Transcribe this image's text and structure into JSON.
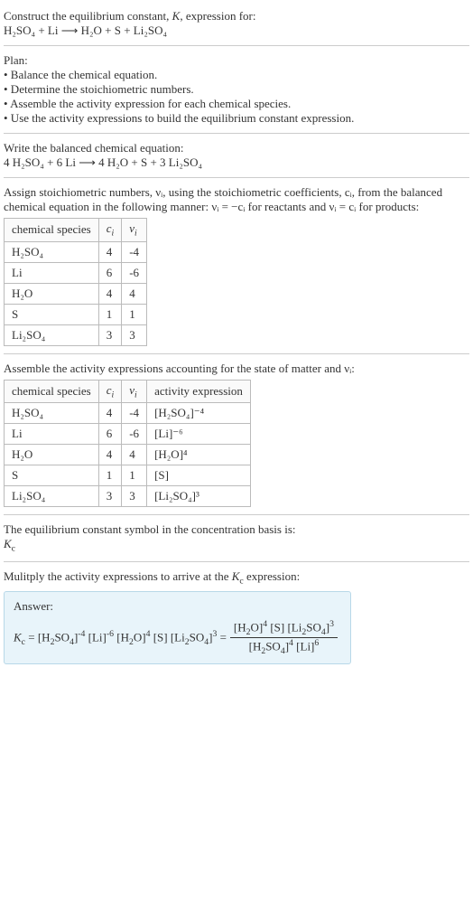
{
  "prompt": {
    "line1": "Construct the equilibrium constant, K, expression for:",
    "eq": "H₂SO₄ + Li ⟶ H₂O + S + Li₂SO₄"
  },
  "plan": {
    "title": "Plan:",
    "items": [
      "• Balance the chemical equation.",
      "• Determine the stoichiometric numbers.",
      "• Assemble the activity expression for each chemical species.",
      "• Use the activity expressions to build the equilibrium constant expression."
    ]
  },
  "balanced": {
    "title": "Write the balanced chemical equation:",
    "eq": "4 H₂SO₄ + 6 Li ⟶ 4 H₂O + S + 3 Li₂SO₄"
  },
  "assign": {
    "text": "Assign stoichiometric numbers, νᵢ, using the stoichiometric coefficients, cᵢ, from the balanced chemical equation in the following manner: νᵢ = −cᵢ for reactants and νᵢ = cᵢ for products:",
    "headers": {
      "h1": "chemical species",
      "h2": "cᵢ",
      "h3": "νᵢ"
    },
    "rows": [
      {
        "sp": "H₂SO₄",
        "c": "4",
        "v": "-4"
      },
      {
        "sp": "Li",
        "c": "6",
        "v": "-6"
      },
      {
        "sp": "H₂O",
        "c": "4",
        "v": "4"
      },
      {
        "sp": "S",
        "c": "1",
        "v": "1"
      },
      {
        "sp": "Li₂SO₄",
        "c": "3",
        "v": "3"
      }
    ]
  },
  "activity": {
    "text": "Assemble the activity expressions accounting for the state of matter and νᵢ:",
    "headers": {
      "h1": "chemical species",
      "h2": "cᵢ",
      "h3": "νᵢ",
      "h4": "activity expression"
    },
    "rows": [
      {
        "sp": "H₂SO₄",
        "c": "4",
        "v": "-4",
        "a": "[H₂SO₄]⁻⁴"
      },
      {
        "sp": "Li",
        "c": "6",
        "v": "-6",
        "a": "[Li]⁻⁶"
      },
      {
        "sp": "H₂O",
        "c": "4",
        "v": "4",
        "a": "[H₂O]⁴"
      },
      {
        "sp": "S",
        "c": "1",
        "v": "1",
        "a": "[S]"
      },
      {
        "sp": "Li₂SO₄",
        "c": "3",
        "v": "3",
        "a": "[Li₂SO₄]³"
      }
    ]
  },
  "symbol": {
    "line1": "The equilibrium constant symbol in the concentration basis is:",
    "line2": "K𝚌"
  },
  "multiply": {
    "text": "Mulitply the activity expressions to arrive at the K𝚌 expression:"
  },
  "answer": {
    "label": "Answer:",
    "lhs": "K𝚌 = [H₂SO₄]⁻⁴ [Li]⁻⁶ [H₂O]⁴ [S] [Li₂SO₄]³ = ",
    "num": "[H₂O]⁴ [S] [Li₂SO₄]³",
    "den": "[H₂SO₄]⁴ [Li]⁶"
  }
}
